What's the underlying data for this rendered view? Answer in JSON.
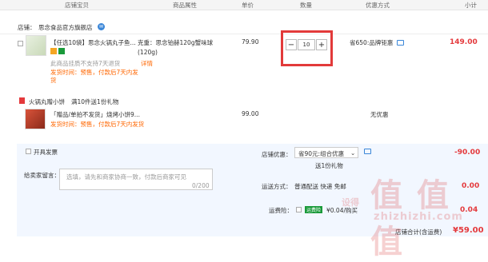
{
  "header": {
    "cols": [
      "店铺宝贝",
      "商品属性",
      "单价",
      "数量",
      "优惠方式",
      "小计"
    ]
  },
  "store": {
    "prefix": "店铺：",
    "name": "思念食品官方旗舰店"
  },
  "item1": {
    "title": "【任选10袋】思念火锅丸子鱼...",
    "attr": "克重：思念铂赫120g蟹味球(120g)",
    "price": "79.90",
    "qty": "10",
    "minus": "−",
    "plus": "+",
    "discount": "省650:品牌钜惠",
    "subtotal": "149.00",
    "notice1": "此商品挂质不支持7天退货",
    "notice1_link": "详情",
    "notice2": "发货时间：预售，付款后7天内发货"
  },
  "promo": {
    "label": "火锅丸赠小饼",
    "desc": "满10件送1份礼物"
  },
  "item2": {
    "title": "「赠品/单拍不发货」烧烤小饼9...",
    "price": "99.00",
    "discount": "无优惠",
    "notice": "发货时间：预售，付款后7天内发货"
  },
  "footer": {
    "invoice": "开具发票",
    "message_label": "给卖家留言：",
    "message_placeholder": "选填，请先和商家协商一致，付款后商家可见",
    "message_count": "0/200",
    "shop_discount_label": "店铺优惠：",
    "shop_discount_value": "省90元:组合优惠",
    "shop_discount_sub": "送1份礼物",
    "shop_discount_amount": "-90.00",
    "shipping_label": "运送方式：",
    "shipping_value": "普通配送 快递 免邮",
    "shipping_amount": "0.00",
    "insurance_label": "运费险：",
    "insurance_tag": "运费险",
    "insurance_value": "¥0.04/购买",
    "insurance_amount": "0.04",
    "total_label": "店铺合计(含运费)",
    "total_amount": "¥59.00"
  },
  "watermark": {
    "site": "zhizhizhi.com",
    "brand": "值 值 值",
    "small": "设得"
  },
  "colors": {
    "accent_red": "#e4393c",
    "highlight_box": "#e23a3a",
    "footer_bg": "#f2f7ff"
  }
}
